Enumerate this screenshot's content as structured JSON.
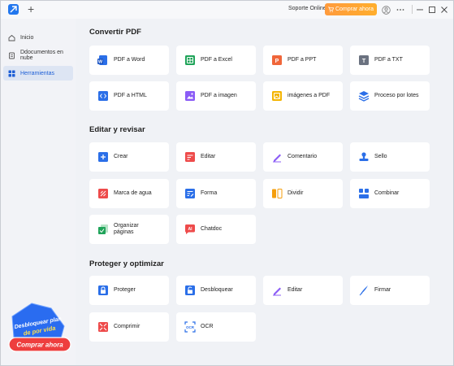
{
  "titlebar": {
    "new_tab": "+",
    "support": "Soporte Online",
    "buy": "Comprar ahora"
  },
  "sidebar": {
    "items": [
      {
        "label": "Inicio"
      },
      {
        "label": "Ddocumentos en nube"
      },
      {
        "label": "Herramientas"
      }
    ],
    "promo": {
      "line1": "Desbloquear plan",
      "line2": "de por vida",
      "button": "Comprar ahora"
    }
  },
  "sections": [
    {
      "title": "Convertir PDF",
      "cards": [
        {
          "label": "PDF a Word",
          "icon": "word-icon",
          "color": "#2b6fe8"
        },
        {
          "label": "PDF a Excel",
          "icon": "excel-icon",
          "color": "#20a45a"
        },
        {
          "label": "PDF a PPT",
          "icon": "ppt-icon",
          "color": "#f0663a"
        },
        {
          "label": "PDF a TXT",
          "icon": "txt-icon",
          "color": "#6b7280"
        },
        {
          "label": "PDF a HTML",
          "icon": "html-icon",
          "color": "#2b6fe8"
        },
        {
          "label": "PDF a imagen",
          "icon": "image-icon",
          "color": "#8b5cf6"
        },
        {
          "label": "imágenes a PDF",
          "icon": "images-to-pdf-icon",
          "color": "#f4b400"
        },
        {
          "label": "Proceso por lotes",
          "icon": "batch-icon",
          "color": "#2b6fe8"
        }
      ]
    },
    {
      "title": "Editar y revisar",
      "cards": [
        {
          "label": "Crear",
          "icon": "plus-icon",
          "color": "#2b6fe8"
        },
        {
          "label": "Editar",
          "icon": "edit-icon",
          "color": "#ee4b4b"
        },
        {
          "label": "Comentario",
          "icon": "comment-icon",
          "color": "#8b5cf6"
        },
        {
          "label": "Sello",
          "icon": "stamp-icon",
          "color": "#2b6fe8"
        },
        {
          "label": "Marca de agua",
          "icon": "watermark-icon",
          "color": "#ee4b4b"
        },
        {
          "label": "Forma",
          "icon": "form-icon",
          "color": "#2b6fe8"
        },
        {
          "label": "Dividir",
          "icon": "split-icon",
          "color": "#f59e0b"
        },
        {
          "label": "Combinar",
          "icon": "combine-icon",
          "color": "#2b6fe8"
        },
        {
          "label": "Organizar páginas",
          "icon": "organize-icon",
          "color": "#20a45a"
        },
        {
          "label": "Chatdoc",
          "icon": "chat-icon",
          "color": "#ee4b4b"
        }
      ]
    },
    {
      "title": "Proteger y optimizar",
      "cards": [
        {
          "label": "Proteger",
          "icon": "lock-icon",
          "color": "#2b6fe8"
        },
        {
          "label": "Desbloquear",
          "icon": "unlock-icon",
          "color": "#2b6fe8"
        },
        {
          "label": "Editar",
          "icon": "edit-pen-icon",
          "color": "#8b5cf6"
        },
        {
          "label": "Firmar",
          "icon": "sign-icon",
          "color": "#2b6fe8"
        },
        {
          "label": "Comprimir",
          "icon": "compress-icon",
          "color": "#ee4b4b"
        },
        {
          "label": "OCR",
          "icon": "ocr-icon",
          "color": "#2b6fe8"
        }
      ]
    }
  ]
}
